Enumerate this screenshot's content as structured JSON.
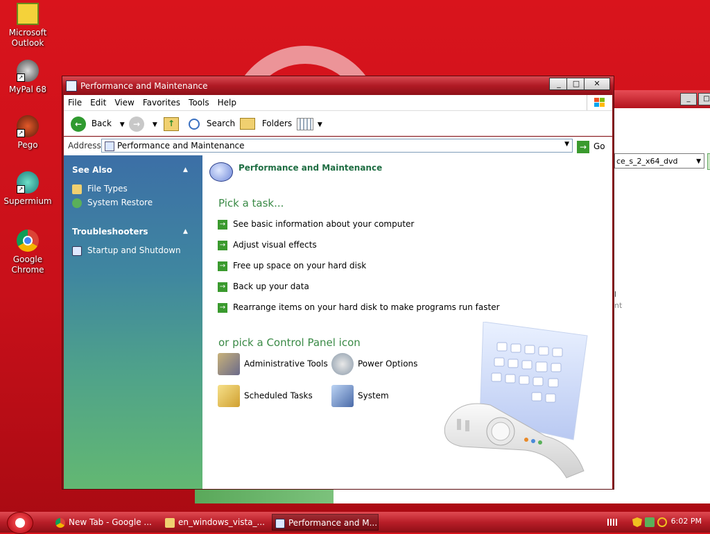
{
  "desktop": {
    "icons": [
      {
        "label_line1": "Microsoft",
        "label_line2": "Outlook"
      },
      {
        "label_line1": "MyPal 68",
        "label_line2": ""
      },
      {
        "label_line1": "Pego",
        "label_line2": ""
      },
      {
        "label_line1": "Supermium",
        "label_line2": ""
      },
      {
        "label_line1": "Google",
        "label_line2": "Chrome"
      }
    ]
  },
  "bg_window": {
    "combo_value": "ce_s_2_x64_dvd",
    "text1": "l",
    "text2": "nt"
  },
  "window": {
    "title": "Performance and Maintenance",
    "controls": {
      "minimize": "_",
      "maximize": "□",
      "close": "✕"
    },
    "menu": [
      "File",
      "Edit",
      "View",
      "Favorites",
      "Tools",
      "Help"
    ],
    "toolbar": {
      "back": "Back",
      "search": "Search",
      "folders": "Folders"
    },
    "address": {
      "label": "Address",
      "value": "Performance and Maintenance",
      "go": "Go"
    },
    "sidebar": {
      "see_also_title": "See Also",
      "see_also_items": [
        "File Types",
        "System Restore"
      ],
      "troubleshooters_title": "Troubleshooters",
      "troubleshooters_items": [
        "Startup and Shutdown"
      ]
    },
    "content": {
      "category_title": "Performance and Maintenance",
      "pick_task": "Pick a task...",
      "tasks": [
        "See basic information about your computer",
        "Adjust visual effects",
        "Free up space on your hard disk",
        "Back up your data",
        "Rearrange items on your hard disk to make programs run faster"
      ],
      "or_pick": "or pick a Control Panel icon",
      "cp_icons": [
        "Administrative Tools",
        "Power Options",
        "Scheduled Tasks",
        "System"
      ]
    }
  },
  "taskbar": {
    "buttons": [
      "New Tab - Google ...",
      "en_windows_vista_...",
      "Performance and M..."
    ],
    "clock": "6:02 PM"
  }
}
